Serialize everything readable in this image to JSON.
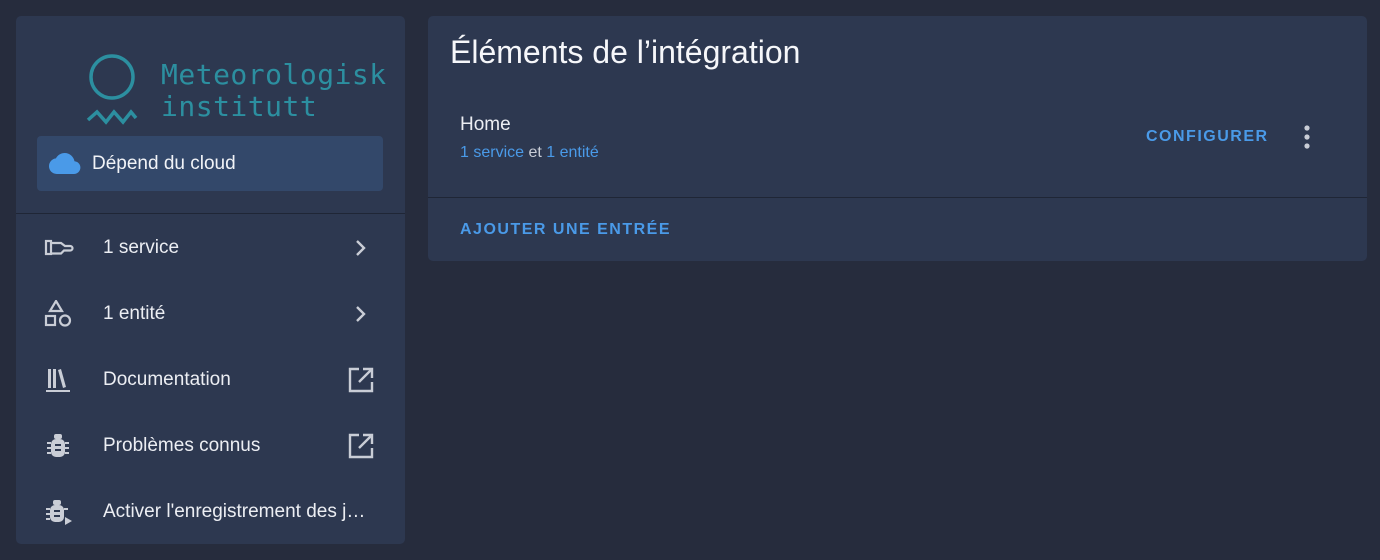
{
  "sidebar": {
    "logo": {
      "line1": "Meteorologisk",
      "line2": "institutt"
    },
    "cloud_badge": {
      "icon": "cloud-icon",
      "label": "Dépend du cloud"
    },
    "items": [
      {
        "icon": "service-icon",
        "label": "1 service",
        "trailing": "chevron-right-icon"
      },
      {
        "icon": "shapes-icon",
        "label": "1 entité",
        "trailing": "chevron-right-icon"
      },
      {
        "icon": "bookshelf-icon",
        "label": "Documentation",
        "trailing": "open-in-new-icon"
      },
      {
        "icon": "bug-icon",
        "label": "Problèmes connus",
        "trailing": "open-in-new-icon"
      },
      {
        "icon": "bug-play-icon",
        "label": "Activer l'enregistrement des journaux de débogage",
        "trailing": ""
      }
    ]
  },
  "main": {
    "title": "Éléments de l’intégration",
    "entry": {
      "name": "Home",
      "service_link": "1 service",
      "conjunction": "et",
      "entity_link": "1 entité",
      "configure_label": "CONFIGURER",
      "menu_icon": "dots-vertical-icon"
    },
    "add_entry_label": "AJOUTER UNE ENTRÉE"
  },
  "colors": {
    "background": "#262c3d",
    "card": "#2d3850",
    "accent": "#4a9ae8",
    "logo": "#2c8fa0",
    "cloud_chip": "#33486a"
  }
}
